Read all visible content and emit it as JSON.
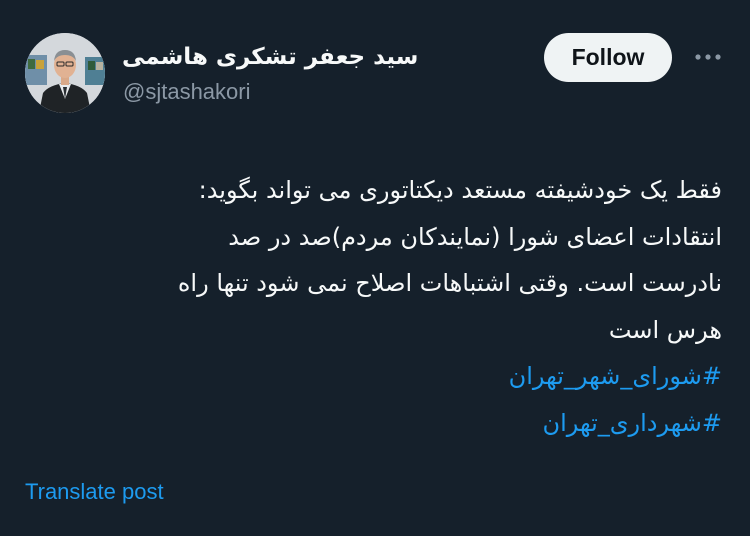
{
  "author": {
    "display_name": "سید جعفر تشکری هاشمی",
    "handle": "@sjtashakori"
  },
  "actions": {
    "follow_label": "Follow",
    "more_icon": "more-horizontal-icon"
  },
  "post": {
    "lines": [
      "فقط یک خودشیفته مستعد دیکتاتوری می تواند بگوید:",
      "انتقادات اعضای شورا (نمایندکان مردم)صد در صد",
      "نادرست است. وقتی اشتباهات اصلاح نمی شود تنها راه",
      "هرس  است"
    ],
    "hashtags": [
      "#شورای_شهر_تهران",
      "#شهرداری_تهران"
    ]
  },
  "footer": {
    "translate_label": "Translate post"
  },
  "colors": {
    "background": "#15202b",
    "text": "#f7f9f9",
    "secondary_text": "#8b98a5",
    "accent": "#1d9bf0",
    "follow_button_bg": "#eff3f4"
  }
}
